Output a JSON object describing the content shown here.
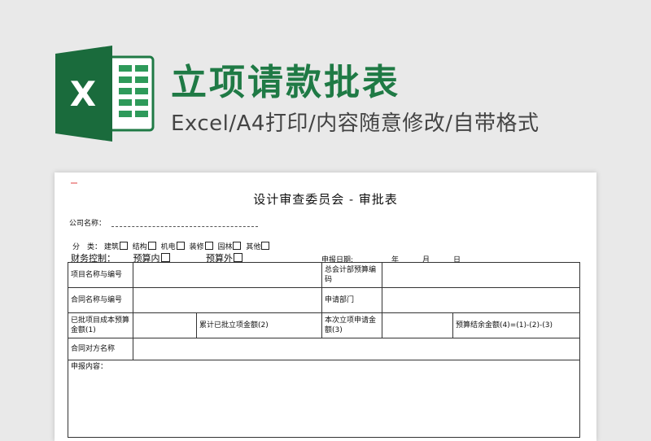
{
  "banner": {
    "title": "立项请款批表",
    "subtitle": "Excel/A4打印/内容随意修改/自带格式",
    "logo_icon": "excel-logo-icon",
    "logo_letter": "X",
    "colors": {
      "title": "#1f7a45",
      "logo_dark": "#1a6b3c",
      "logo_light": "#2e9a5a"
    }
  },
  "form": {
    "title": "设计审查委员会 - 审批表",
    "company_label": "公司名称：",
    "category": {
      "label": "分　类：",
      "options": [
        "建筑",
        "结构",
        "机电",
        "装修",
        "园林",
        "其他"
      ]
    },
    "finance": {
      "label": "财务控制：",
      "options": [
        "预算内",
        "预算外"
      ]
    },
    "apply_date": {
      "label": "申报日期:",
      "year": "年",
      "month": "月",
      "day": "日"
    },
    "table": {
      "project_name": "项目名称与编号",
      "budget_code": "总会计部预算编码",
      "contract_name": "合同名称与编号",
      "apply_dept": "申请部门",
      "approved_cost": "已批项目成本预算金额(1)",
      "accumulated": "累计已批立项金额(2)",
      "current_apply": "本次立项申请金额(3)",
      "budget_balance": "预算结余金额(4)=(1)-(2)-(3)",
      "counterparty": "合同对方名称",
      "content": "申报内容："
    }
  }
}
